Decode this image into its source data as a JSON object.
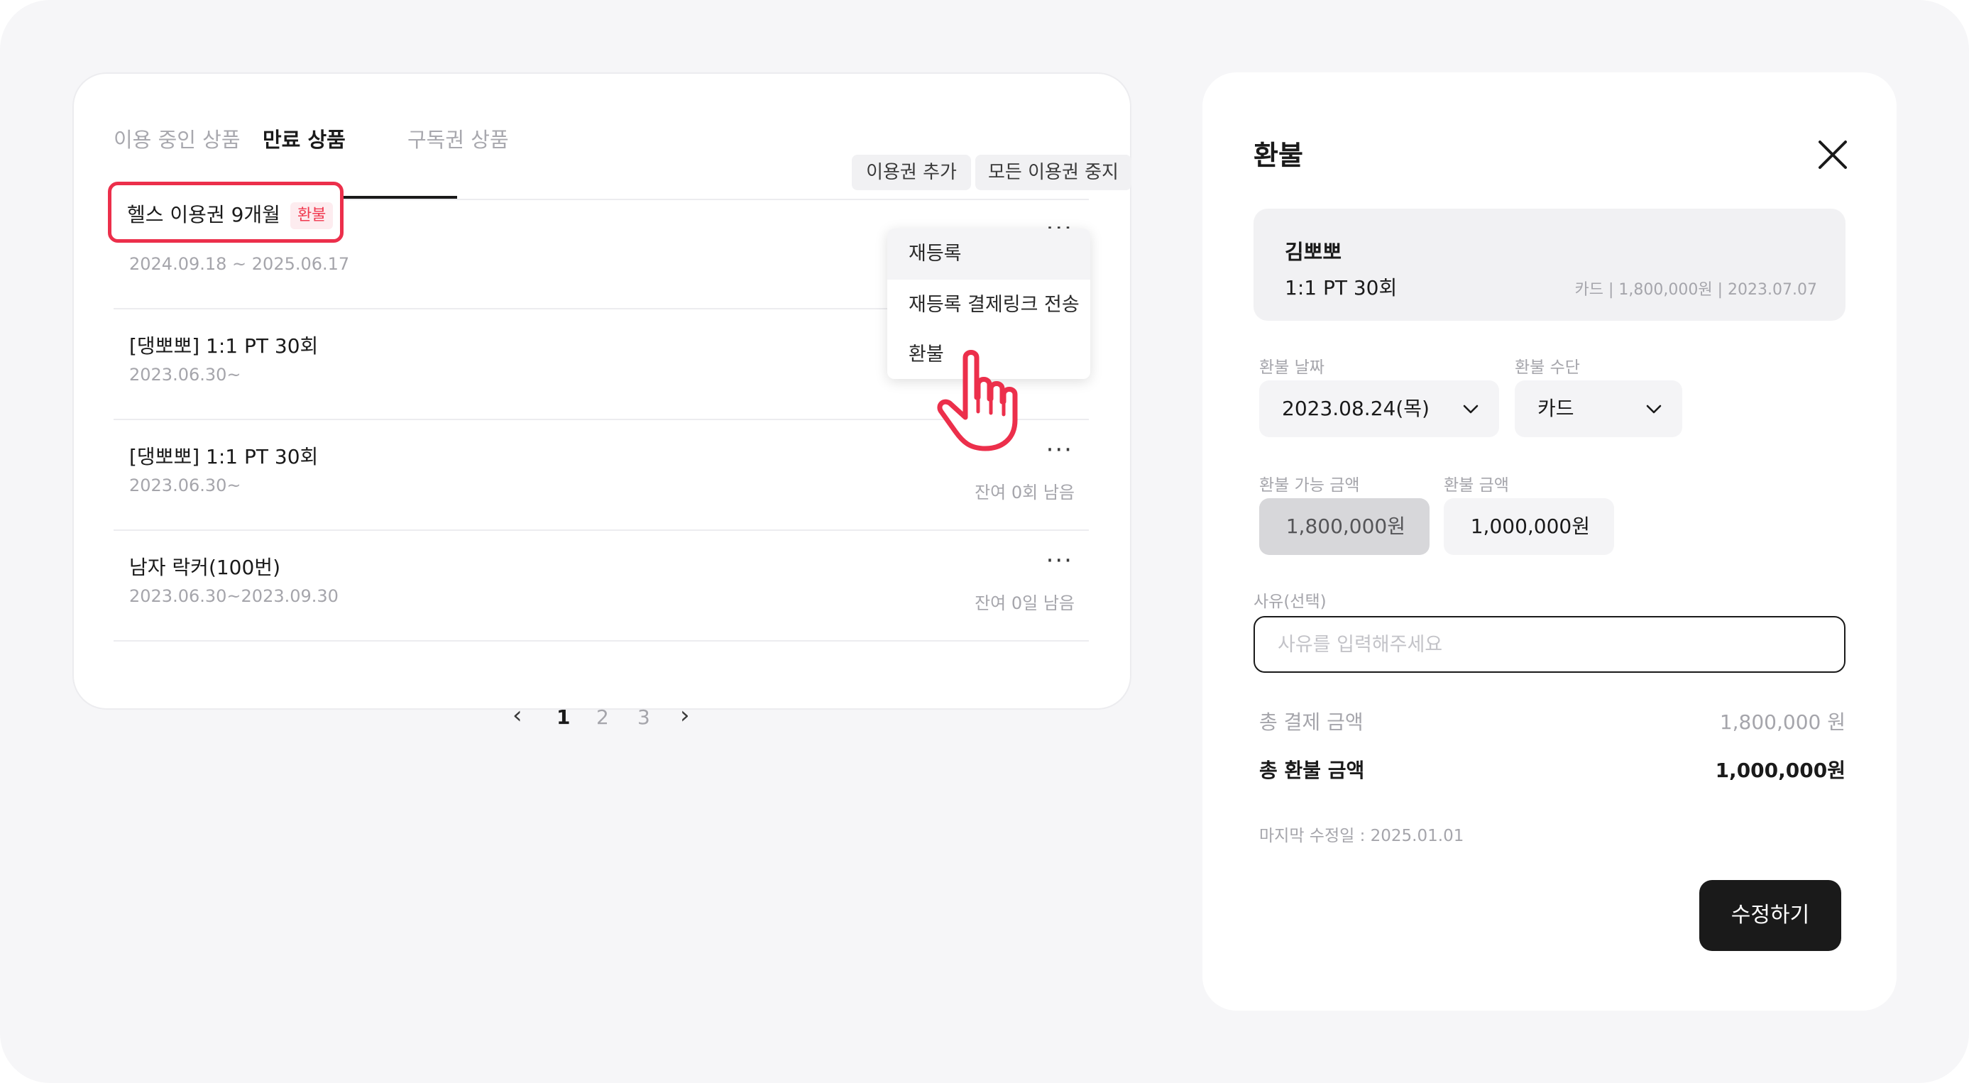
{
  "tabs": [
    {
      "label": "이용 중인 상품"
    },
    {
      "label": "만료 상품"
    },
    {
      "label": "구독권 상품"
    }
  ],
  "actions": {
    "add_pass": "이용권 추가",
    "stop_all": "모든 이용권 중지"
  },
  "products": [
    {
      "title": "헬스 이용권 9개월",
      "badge": "환불",
      "date": "2024.09.18 ~ 2025.06.17",
      "remain": ""
    },
    {
      "title": "[댕뽀뽀] 1:1 PT 30회",
      "date": "2023.06.30~",
      "remain": ""
    },
    {
      "title": "[댕뽀뽀] 1:1 PT 30회",
      "date": "2023.06.30~",
      "remain": "잔여 0회 남음"
    },
    {
      "title": "남자 락커(100번)",
      "date": "2023.06.30~2023.09.30",
      "remain": "잔여 0일 남음"
    }
  ],
  "more_icon": "···",
  "context_menu": [
    {
      "label": "재등록"
    },
    {
      "label": "재등록 결제링크 전송"
    },
    {
      "label": "환불"
    }
  ],
  "pagination": {
    "prev": "‹",
    "pages": [
      "1",
      "2",
      "3"
    ],
    "next": "›",
    "current": "1"
  },
  "refund_panel": {
    "title": "환불",
    "member_name": "김뽀뽀",
    "product": "1:1 PT 30회",
    "meta": "카드 | 1,800,000원 | 2023.07.07",
    "date_label": "환불 날짜",
    "date_value": "2023.08.24(목)",
    "method_label": "환불 수단",
    "method_value": "카드",
    "available_label": "환불 가능 금액",
    "available_value": "1,800,000원",
    "amount_label": "환불 금액",
    "amount_value": "1,000,000원",
    "reason_label": "사유(선택)",
    "reason_placeholder": "사유를 입력해주세요",
    "total_paid_label": "총 결제 금액",
    "total_paid_value": "1,800,000 원",
    "total_refund_label": "총 환불 금액",
    "total_refund_value": "1,000,000원",
    "last_modified": "마지막 수정일 : 2025.01.01",
    "submit_label": "수정하기"
  },
  "colors": {
    "accent_red": "#ec2f4b",
    "primary_dark": "#1a1a1a",
    "muted_text": "#a5a5ab"
  }
}
